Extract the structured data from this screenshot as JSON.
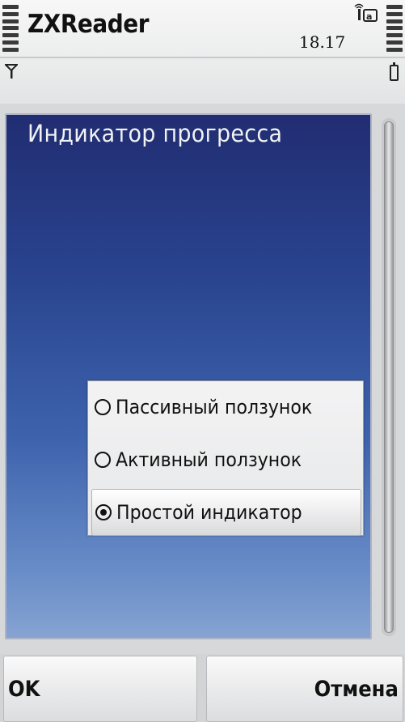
{
  "status_bar": {
    "app_title": "ZXReader",
    "clock": "18.17",
    "signal_icon": "antenna-icon",
    "battery_icon": "battery-icon"
  },
  "dialog": {
    "title": "Индикатор прогресса",
    "options": [
      {
        "label": "Пассивный ползунок",
        "selected": false
      },
      {
        "label": "Активный ползунок",
        "selected": false
      },
      {
        "label": "Простой индикатор",
        "selected": true
      }
    ]
  },
  "softkeys": {
    "left": "OK",
    "right": "Отмена"
  },
  "colors": {
    "panel_top": "#212d72",
    "panel_bottom": "#86a3d2",
    "chrome": "#ecedee"
  }
}
